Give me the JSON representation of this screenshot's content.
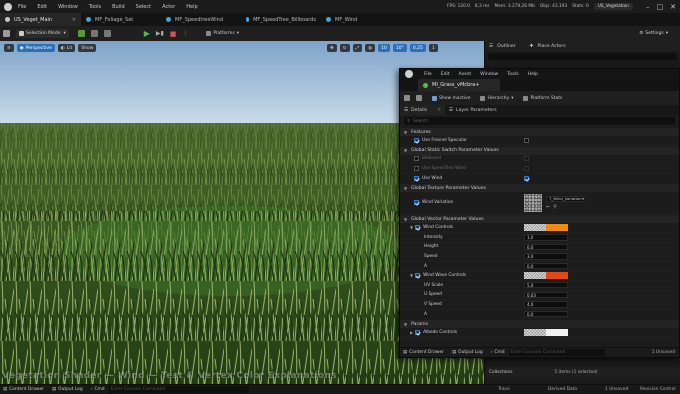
{
  "app": {
    "menu": [
      "File",
      "Edit",
      "Window",
      "Tools",
      "Build",
      "Select",
      "Actor",
      "Help"
    ],
    "stats": {
      "fps": "FPS: 120.0",
      "ms": "8,3 ms",
      "mem": "Mem: 3.279,26 Mb",
      "objs": "Objs: 43.193",
      "stats": "Stats: 0"
    },
    "project_name": "US_Vegetation"
  },
  "tabs": [
    {
      "label": "US_Veget_Main"
    },
    {
      "label": "MF_Foliage_Set"
    },
    {
      "label": "MF_SpeedtreeWind"
    },
    {
      "label": "MF_SpeedTree_Billboards"
    },
    {
      "label": "MF_Wind"
    }
  ],
  "toolbar": {
    "mode": "Selection Mode",
    "platforms": "Platforms",
    "settings": "Settings"
  },
  "viewport": {
    "perspective": "Perspective",
    "lit": "Lit",
    "show": "Show",
    "grid_val": "10",
    "rot_val": "10°",
    "scale_val": "0,25",
    "cam_val": "1"
  },
  "outliner": {
    "tab": "Outliner",
    "place": "Place Actors"
  },
  "material": {
    "menu": [
      "File",
      "Edit",
      "Asset",
      "Window",
      "Tools",
      "Help"
    ],
    "tab_title": "MI_Grass_vMcbra+",
    "show_inactive": "Show Inactive",
    "hierarchy": "Hierarchy",
    "platform_stats": "Platform Stats",
    "details_tab": "Details",
    "layer_tab": "Layer Parameters",
    "search_placeholder": "Search",
    "sections": {
      "features": "Features",
      "static_switch": "Global Static Switch Parameter Values",
      "texture": "Global Texture Parameter Values",
      "vector": "Global Vector Parameter Values",
      "params": "Params"
    },
    "features_rows": [
      {
        "label": "Use Fresnel Specular"
      }
    ],
    "switch_rows": [
      {
        "label": "Billboard"
      },
      {
        "label": "Use SpeedTree Wind"
      },
      {
        "label": "Use Wind"
      }
    ],
    "texture_row": {
      "label": "Wind Variation",
      "asset": "T_Wind_Variation"
    },
    "wind_controls": {
      "label": "Wind Controls",
      "color": "#f08a12",
      "channels": [
        {
          "label": "Intensity",
          "value": "1,0"
        },
        {
          "label": "Height",
          "value": "0,0"
        },
        {
          "label": "Speed",
          "value": "3,0"
        },
        {
          "label": "A",
          "value": "0,0"
        }
      ]
    },
    "wind_wave": {
      "label": "Wind Wave Controls",
      "color": "#e04a16",
      "channels": [
        {
          "label": "UV Scale",
          "value": "5,0"
        },
        {
          "label": "U Speed",
          "value": "0,03"
        },
        {
          "label": "V Speed",
          "value": "4,0"
        },
        {
          "label": "A",
          "value": "0,0"
        }
      ]
    },
    "albedo": {
      "label": "Albedo Controls",
      "color": "#f0f0f0"
    }
  },
  "right_bottom": {
    "unsaved": "1 Unsaved",
    "rev": "Revision Control",
    "items_text": "5 items (1 selected)",
    "collections": "Collections"
  },
  "bottom": {
    "content_drawer": "Content Drawer",
    "output_log": "Output Log",
    "cmd": "Cmd",
    "console_placeholder": "Enter Console Command",
    "trace": "Trace",
    "derived": "Derived Data",
    "unsaved": "1 Unsaved",
    "revision": "Revision Control"
  },
  "video_title": "Vegetation Shader — Wind — Test & Vertex Color Explanations",
  "colors": {
    "accent": "#2a6fb8",
    "orange": "#f08a12",
    "red": "#e04a16",
    "grass": "#2f5a1c"
  }
}
